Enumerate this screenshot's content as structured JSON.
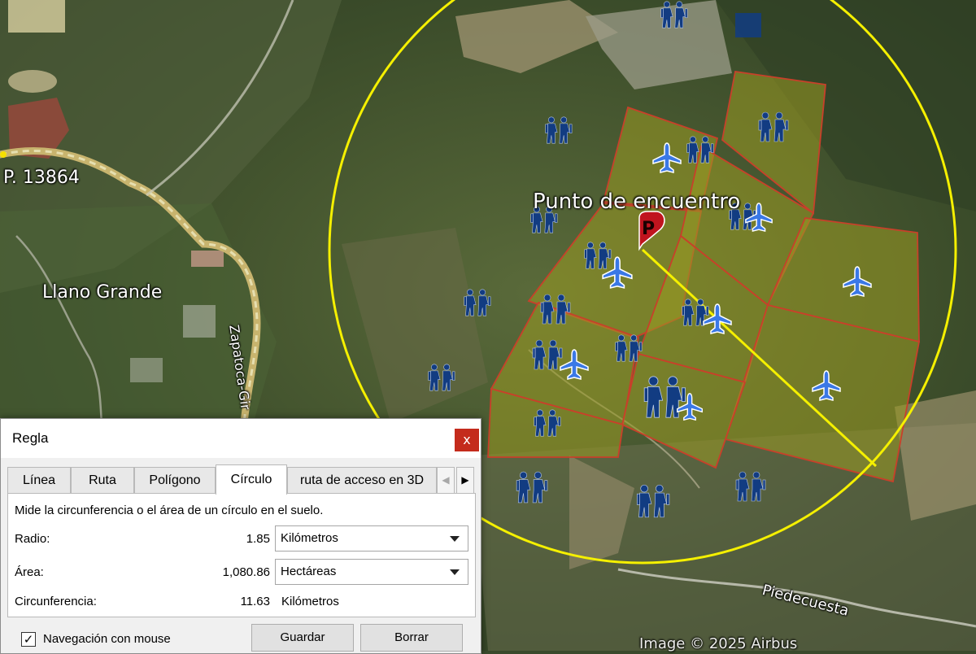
{
  "map": {
    "labels": {
      "llano_grande": "Llano Grande",
      "road_marker": "P. 13864",
      "meeting_point": "Punto de encuentro",
      "road_zapatoca": "Zapatoca-Gir",
      "road_piedecuesta": "Piedecuesta",
      "imagery_credit": "Image © 2025 Airbus"
    },
    "placemark_letter": "P",
    "colors": {
      "circle": "#f5f000",
      "parcel_fill": "#9a9a22",
      "parcel_border": "#c8402a",
      "icon_blue": "#2f6fe0",
      "hiker_blue": "#123c82",
      "placemark_red": "#c0141e"
    },
    "icons": [
      "hiker-icon",
      "airport-icon",
      "placemark-icon"
    ]
  },
  "dialog": {
    "title": "Regla",
    "close_glyph": "x",
    "tabs": [
      "Línea",
      "Ruta",
      "Polígono",
      "Círculo",
      "ruta de acceso en 3D"
    ],
    "active_tab": "Círculo",
    "description": "Mide la circunferencia o el área de un círculo en el suelo.",
    "radius": {
      "label": "Radio:",
      "value": "1.85",
      "unit": "Kilómetros"
    },
    "area": {
      "label": "Área:",
      "value": "1,080.86",
      "unit": "Hectáreas"
    },
    "circumference": {
      "label": "Circunferencia:",
      "value": "11.63",
      "unit": "Kilómetros"
    },
    "mouse_nav": {
      "label": "Navegación con mouse",
      "checked": true,
      "check_glyph": "✓"
    },
    "save_button": "Guardar",
    "delete_button": "Borrar",
    "scroll_left_glyph": "◀",
    "scroll_right_glyph": "▶"
  }
}
